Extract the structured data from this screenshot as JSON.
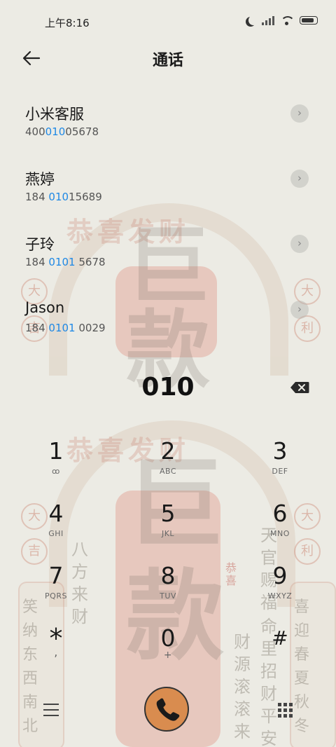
{
  "status_bar": {
    "time": "上午8:16"
  },
  "header": {
    "title": "通话"
  },
  "contacts": [
    {
      "name": "小米客服",
      "number_pre": "400",
      "number_match": "010",
      "number_post": "05678"
    },
    {
      "name": "燕婷",
      "number_pre": "184 ",
      "number_match": "010",
      "number_post": "15689"
    },
    {
      "name": "子玲",
      "number_pre": "184 ",
      "number_match": "0101",
      "number_post": " 5678"
    },
    {
      "name": "Jason",
      "number_pre": "184 ",
      "number_match": "0101",
      "number_post": " 0029"
    }
  ],
  "dial": {
    "value": "010"
  },
  "keypad": [
    {
      "digit": "1",
      "letters": "ꝏ"
    },
    {
      "digit": "2",
      "letters": "ABC"
    },
    {
      "digit": "3",
      "letters": "DEF"
    },
    {
      "digit": "4",
      "letters": "GHI"
    },
    {
      "digit": "5",
      "letters": "JKL"
    },
    {
      "digit": "6",
      "letters": "MNO"
    },
    {
      "digit": "7",
      "letters": "PQRS"
    },
    {
      "digit": "8",
      "letters": "TUV"
    },
    {
      "digit": "9",
      "letters": "WXYZ"
    },
    {
      "digit": "*",
      "letters": ","
    },
    {
      "digit": "0",
      "letters": "+"
    },
    {
      "digit": "#",
      "letters": ""
    }
  ],
  "background_art": {
    "banner": "恭喜发财",
    "big_chars": "巨款",
    "left_circles": [
      "大",
      "吉"
    ],
    "right_circles": [
      "大",
      "利"
    ],
    "left_vertical": "八方来财",
    "right_vertical": "天官赐福",
    "left_panel": "笑纳东西南北",
    "right_panel": "喜迎春夏秋冬",
    "center_left_vertical": "财源滚滚来",
    "center_right_vertical": "命里招财",
    "center_right_vertical_2": "平安",
    "stamp": "恭喜"
  },
  "colors": {
    "accent": "#1e88e5",
    "call_button": "#d98c4f",
    "background": "#ecebe4"
  },
  "icons": {
    "back": "arrow-left-icon",
    "chevron": "chevron-right-icon",
    "delete": "backspace-icon",
    "call": "phone-icon",
    "menu": "menu-icon",
    "grid": "dialpad-icon"
  }
}
